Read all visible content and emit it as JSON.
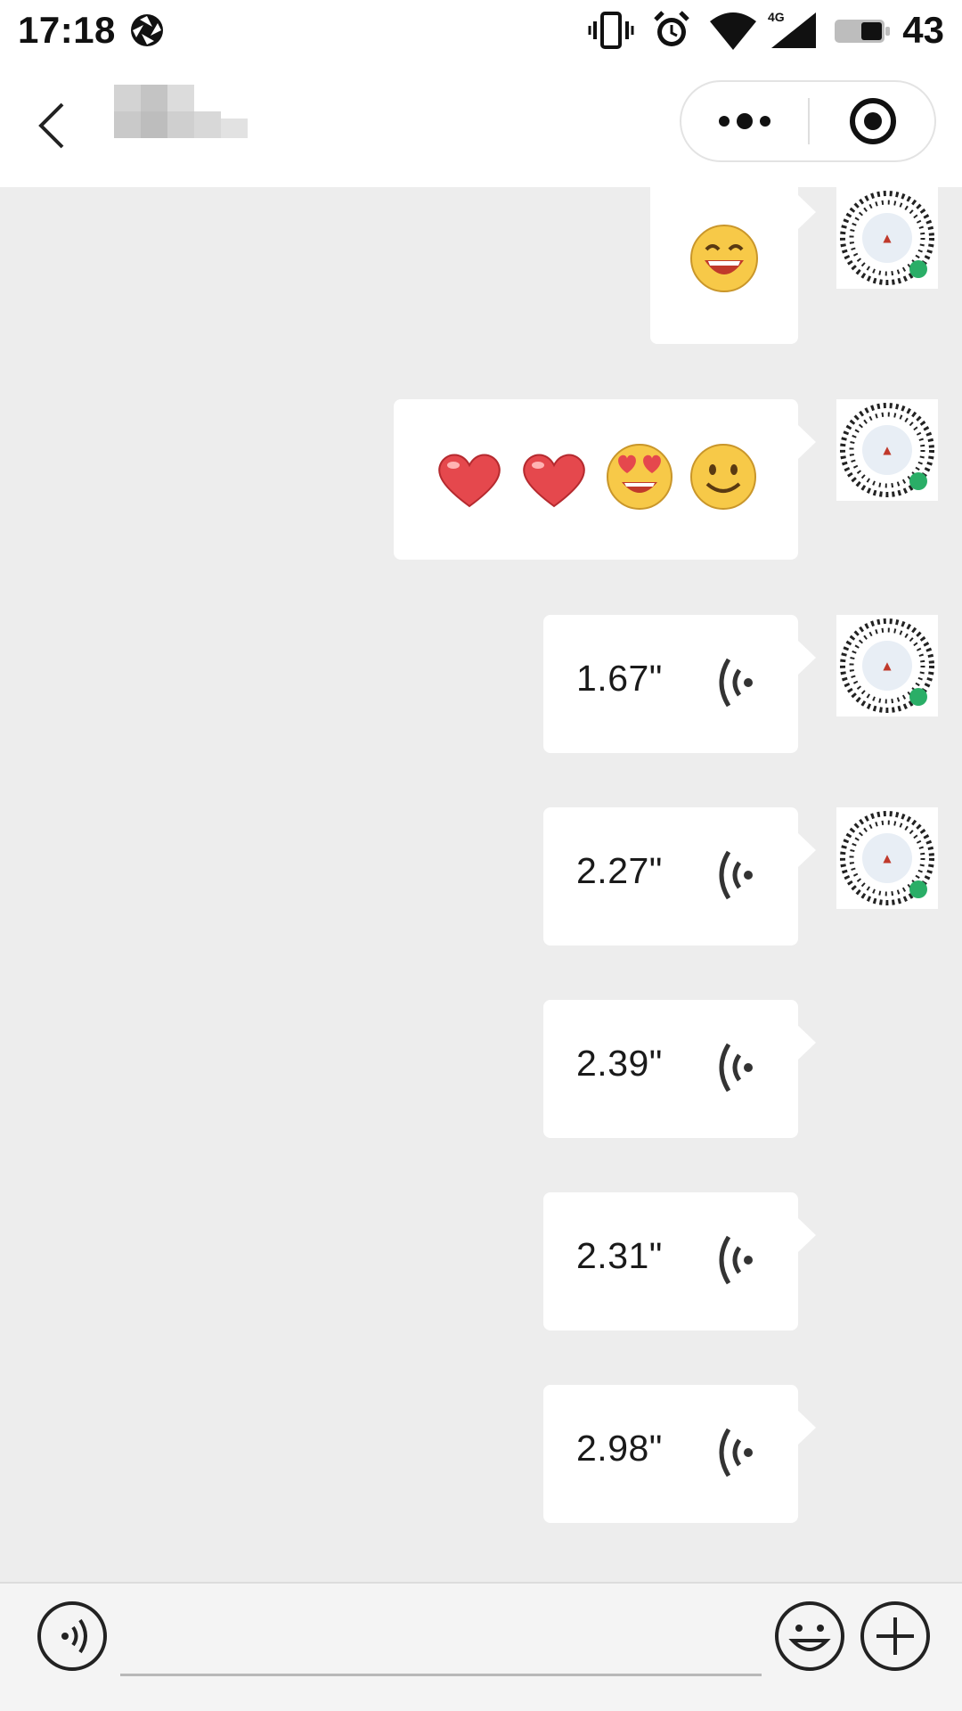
{
  "status_bar": {
    "time": "17:18",
    "battery": "43",
    "network": "4G"
  },
  "nav": {
    "title": "",
    "more_icon": "more-dots-icon",
    "close_icon": "target-close-icon"
  },
  "messages": [
    {
      "type": "emoji",
      "emojis": [
        "laughing-face"
      ]
    },
    {
      "type": "emoji",
      "emojis": [
        "red-heart",
        "red-heart",
        "heart-eyes-face",
        "smiling-face"
      ]
    },
    {
      "type": "voice",
      "duration": "1.67\""
    },
    {
      "type": "voice",
      "duration": "2.27\""
    },
    {
      "type": "voice",
      "duration": "2.39\""
    },
    {
      "type": "voice",
      "duration": "2.31\""
    },
    {
      "type": "voice",
      "duration": "2.98\""
    }
  ],
  "input_bar": {
    "message_placeholder": "",
    "left_icon": "voice-input-icon",
    "emoji_icon": "emoji-smile-icon",
    "plus_icon": "plus-circle-icon"
  },
  "colors": {
    "chat_background": "#ededed",
    "bubble": "#ffffff",
    "header": "#ffffff",
    "mini_program_badge": "#2aae67"
  }
}
